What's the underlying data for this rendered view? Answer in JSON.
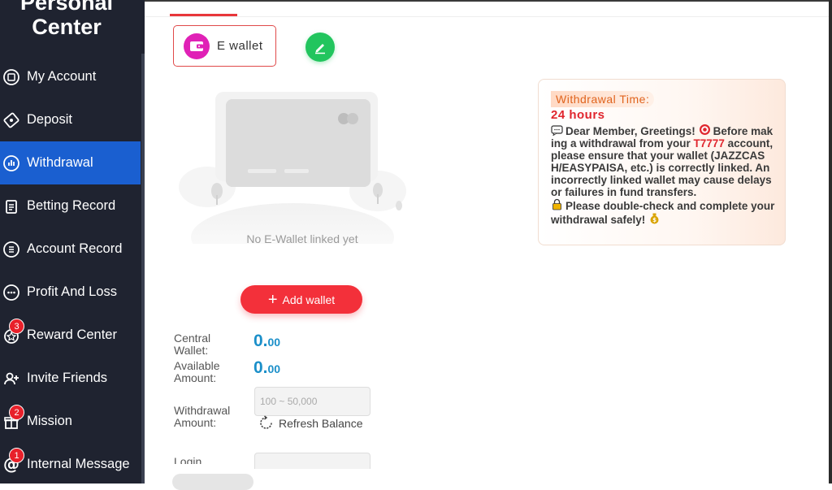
{
  "sidebar": {
    "title": "Personal Center",
    "items": [
      {
        "label": "My Account",
        "icon": "account-icon"
      },
      {
        "label": "Deposit",
        "icon": "deposit-icon"
      },
      {
        "label": "Withdrawal",
        "icon": "withdrawal-icon",
        "active": true
      },
      {
        "label": "Betting Record",
        "icon": "betting-record-icon"
      },
      {
        "label": "Account Record",
        "icon": "account-record-icon"
      },
      {
        "label": "Profit And Loss",
        "icon": "profit-loss-icon"
      },
      {
        "label": "Reward Center",
        "icon": "reward-icon",
        "badge": "3"
      },
      {
        "label": "Invite Friends",
        "icon": "invite-icon"
      },
      {
        "label": "Mission",
        "icon": "gift-icon",
        "badge": "2"
      },
      {
        "label": "Internal Message",
        "icon": "at-icon",
        "badge": "1"
      }
    ]
  },
  "wallet": {
    "tab_label": "E wallet",
    "empty_text": "No E-Wallet linked yet",
    "add_button": "Add wallet"
  },
  "balances": {
    "central_label": "Central Wallet:",
    "central_int": "0.",
    "central_dec": "00",
    "available_label": "Available Amount:",
    "available_int": "0.",
    "available_dec": "00"
  },
  "withdraw": {
    "amount_label": "Withdrawal Amount:",
    "amount_placeholder": "100 ~ 50,000",
    "refresh_label": "Refresh Balance",
    "login_label": "Login"
  },
  "notice": {
    "time_label": "Withdrawal Time:",
    "hours": "24 hours",
    "greeting": "Dear Member, Greetings!",
    "text1": "Before making a withdrawal from your",
    "brand": "T7777",
    "text2": "account, please ensure that your wallet (JAZZCASH/EASYPAISA, etc.) is correctly linked. An incorrectly linked wallet may cause delays or failures in fund transfers.",
    "text3": "Please double-check and complete your withdrawal safely!"
  },
  "colors": {
    "sidebar_bg": "#1f2330",
    "active_item": "#1a5fd0",
    "accent_red": "#f3303a",
    "amount_blue": "#1b8fc9",
    "edit_green": "#22c55e",
    "ewallet_pink": "#e021b6"
  }
}
